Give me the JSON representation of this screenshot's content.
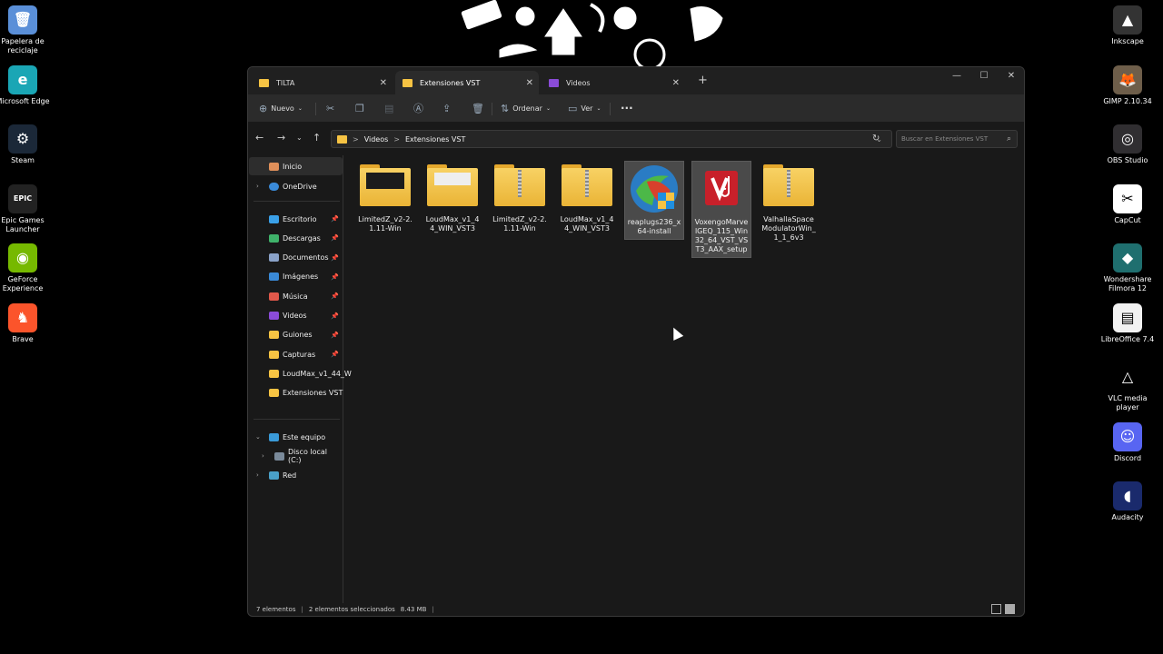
{
  "desktop": {
    "left_icons": [
      {
        "label": "Papelera de reciclaje",
        "icon": "recycle-bin-icon",
        "color": "#5a8fd8",
        "glyph": "🗑"
      },
      {
        "label": "Microsoft Edge",
        "icon": "edge-icon",
        "color": "#1aa6b5",
        "glyph": "e"
      },
      {
        "label": "Steam",
        "icon": "steam-icon",
        "color": "#1b2838",
        "glyph": "⚙"
      },
      {
        "label": "Epic Games Launcher",
        "icon": "epic-games-icon",
        "color": "#222222",
        "glyph": "EPIC"
      },
      {
        "label": "GeForce Experience",
        "icon": "geforce-icon",
        "color": "#76b900",
        "glyph": "◉"
      },
      {
        "label": "Brave",
        "icon": "brave-icon",
        "color": "#fb542b",
        "glyph": "♞"
      }
    ],
    "right_icons": [
      {
        "label": "Inkscape",
        "icon": "inkscape-icon",
        "color": "#333333",
        "glyph": "▲"
      },
      {
        "label": "GIMP 2.10.34",
        "icon": "gimp-icon",
        "color": "#6e5e4a",
        "glyph": "🦊"
      },
      {
        "label": "OBS Studio",
        "icon": "obs-icon",
        "color": "#302e31",
        "glyph": "◎"
      },
      {
        "label": "CapCut",
        "icon": "capcut-icon",
        "color": "#ffffff",
        "glyph": "✂"
      },
      {
        "label": "Wondershare Filmora 12",
        "icon": "filmora-icon",
        "color": "#1f6f6f",
        "glyph": "◆"
      },
      {
        "label": "LibreOffice 7.4",
        "icon": "libreoffice-icon",
        "color": "#f2f2f2",
        "glyph": "▤"
      },
      {
        "label": "VLC media player",
        "icon": "vlc-icon",
        "color": "#000000",
        "glyph": "△"
      },
      {
        "label": "Discord",
        "icon": "discord-icon",
        "color": "#5865f2",
        "glyph": "☺"
      },
      {
        "label": "Audacity",
        "icon": "audacity-icon",
        "color": "#1a2a6c",
        "glyph": "◖"
      }
    ]
  },
  "window": {
    "tabs": [
      {
        "label": "TILTA",
        "icon": "folder-icon",
        "icon_color": "#f6c343"
      },
      {
        "label": "Extensiones VST",
        "icon": "folder-icon",
        "icon_color": "#f6c343"
      },
      {
        "label": "Videos",
        "icon": "videos-folder-icon",
        "icon_color": "#8a4bd8"
      }
    ],
    "new_tab": "+",
    "controls": {
      "minimize": "—",
      "maximize": "☐",
      "close": "✕"
    },
    "toolbar": {
      "new_label": "Nuevo",
      "sort_label": "Ordenar",
      "view_label": "Ver",
      "more": "···"
    },
    "address": {
      "crumbs": [
        "Videos",
        "Extensiones VST"
      ],
      "separator": ">",
      "search_placeholder": "Buscar en Extensiones VST"
    },
    "sidebar": {
      "home": "Inicio",
      "onedrive": "OneDrive",
      "quick": [
        {
          "label": "Escritorio",
          "color": "#3aa0e8",
          "pinned": true
        },
        {
          "label": "Descargas",
          "color": "#3fb26a",
          "pinned": true
        },
        {
          "label": "Documentos",
          "color": "#8aa2c8",
          "pinned": true
        },
        {
          "label": "Imágenes",
          "color": "#3a8ad8",
          "pinned": true
        },
        {
          "label": "Música",
          "color": "#e0584a",
          "pinned": true
        },
        {
          "label": "Videos",
          "color": "#8a4bd8",
          "pinned": true
        },
        {
          "label": "Guiones",
          "color": "#f6c343",
          "pinned": true
        },
        {
          "label": "Capturas",
          "color": "#f6c343",
          "pinned": true
        },
        {
          "label": "LoudMax_v1_44_W",
          "color": "#f6c343",
          "pinned": false
        },
        {
          "label": "Extensiones VST",
          "color": "#f6c343",
          "pinned": false
        }
      ],
      "this_pc": "Este equipo",
      "local_disk": "Disco local (C:)",
      "network": "Red",
      "pin_glyph": "📌"
    },
    "files": [
      {
        "name": "LimitedZ_v2-2.1.11-Win",
        "kind": "folder-dark",
        "selected": false
      },
      {
        "name": "LoudMax_v1_44_WIN_VST3",
        "kind": "folder-paper",
        "selected": false
      },
      {
        "name": "LimitedZ_v2-2.1.11-Win",
        "kind": "zip",
        "selected": false
      },
      {
        "name": "LoudMax_v1_44_WIN_VST3",
        "kind": "zip",
        "selected": false
      },
      {
        "name": "reaplugs236_x64-install",
        "kind": "reaplugs",
        "selected": true
      },
      {
        "name": "VoxengoMarvelGEQ_115_Win32_64_VST_VST3_AAX_setup",
        "kind": "voxengo",
        "selected": true
      },
      {
        "name": "ValhallaSpaceModulatorWin_1_1_6v3",
        "kind": "zip",
        "selected": false
      }
    ],
    "status": {
      "count": "7 elementos",
      "selection": "2 elementos seleccionados",
      "size": "8.43 MB",
      "separator": "|"
    }
  }
}
